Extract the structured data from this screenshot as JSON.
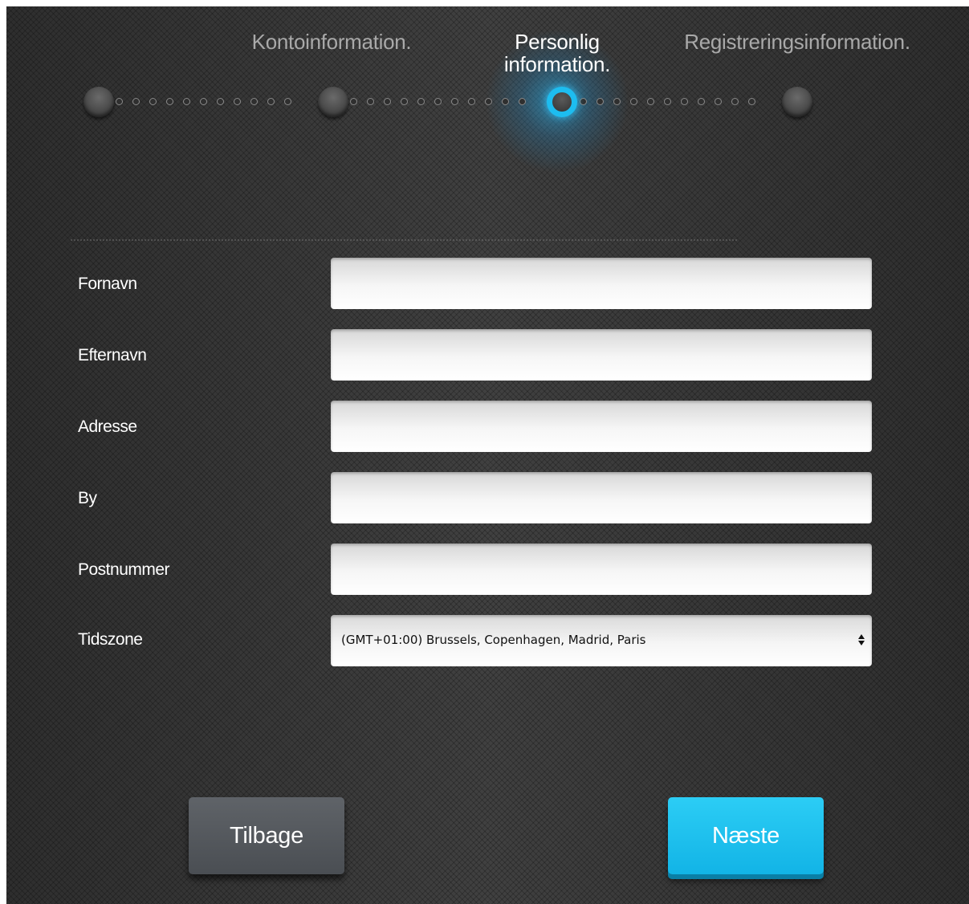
{
  "steps": {
    "step1_label": "Kontoinformation.",
    "step2_label_line1": "Personlig",
    "step2_label_line2": "information.",
    "step3_label": "Registreringsinformation.",
    "current_step": 2,
    "total_steps": 3
  },
  "form": {
    "fornavn_label": "Fornavn",
    "fornavn_value": "",
    "efternavn_label": "Efternavn",
    "efternavn_value": "",
    "adresse_label": "Adresse",
    "adresse_value": "",
    "by_label": "By",
    "by_value": "",
    "postnummer_label": "Postnummer",
    "postnummer_value": "",
    "tidszone_label": "Tidszone",
    "tidszone_selected": "(GMT+01:00) Brussels, Copenhagen, Madrid, Paris"
  },
  "buttons": {
    "back_label": "Tilbage",
    "next_label": "Næste"
  },
  "colors": {
    "accent": "#1dbdf0",
    "background": "#3a3a3a",
    "back_button": "#54585d"
  }
}
